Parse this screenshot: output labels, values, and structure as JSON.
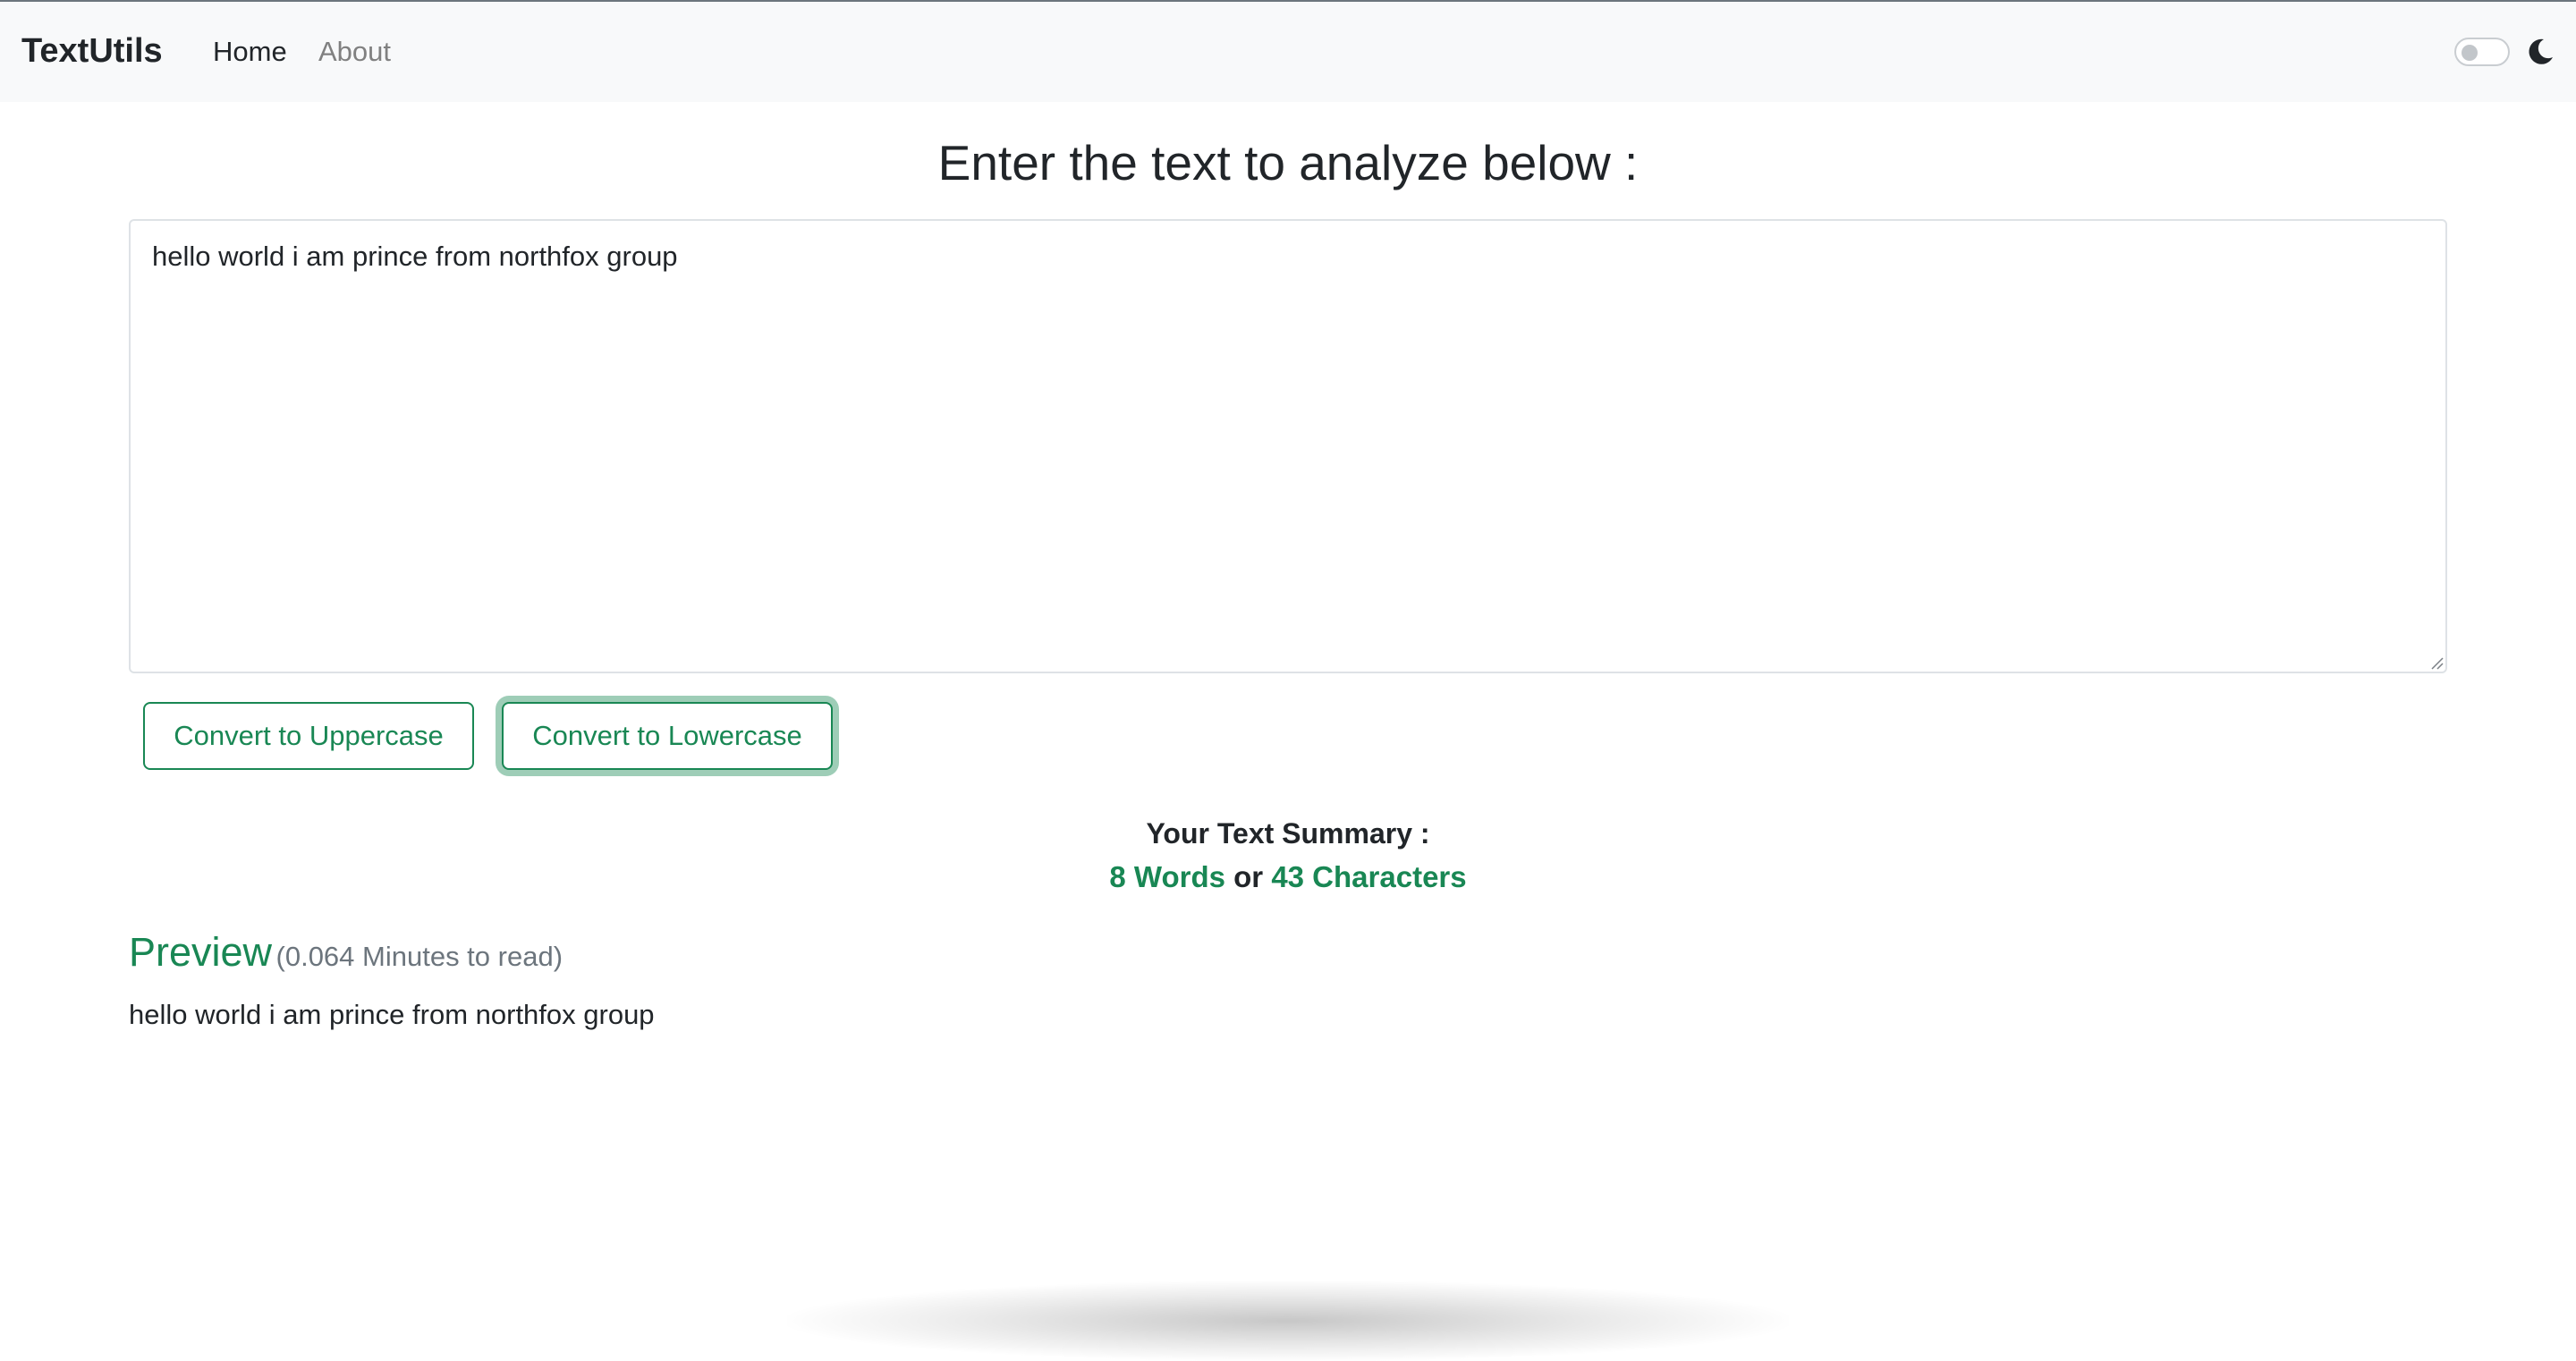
{
  "navbar": {
    "brand": "TextUtils",
    "links": [
      {
        "label": "Home",
        "active": true
      },
      {
        "label": "About",
        "active": false
      }
    ],
    "dark_mode_toggle": {
      "on": false,
      "icon": "moon-icon"
    }
  },
  "main": {
    "heading": "Enter the text to analyze below :",
    "textarea_value": "hello world i am prince from northfox group",
    "buttons": {
      "uppercase": "Convert to Uppercase",
      "lowercase": "Convert to Lowercase"
    },
    "summary": {
      "title": "Your Text Summary :",
      "words": "8 Words",
      "connector": "or",
      "characters": "43 Characters"
    },
    "preview": {
      "title": "Preview",
      "read_time": "(0.064 Minutes to read)",
      "text": "hello world i am prince from northfox group"
    }
  },
  "colors": {
    "accent": "#198754",
    "navbar_bg": "#f8f9fa",
    "text": "#212529",
    "muted": "#6c757d"
  }
}
